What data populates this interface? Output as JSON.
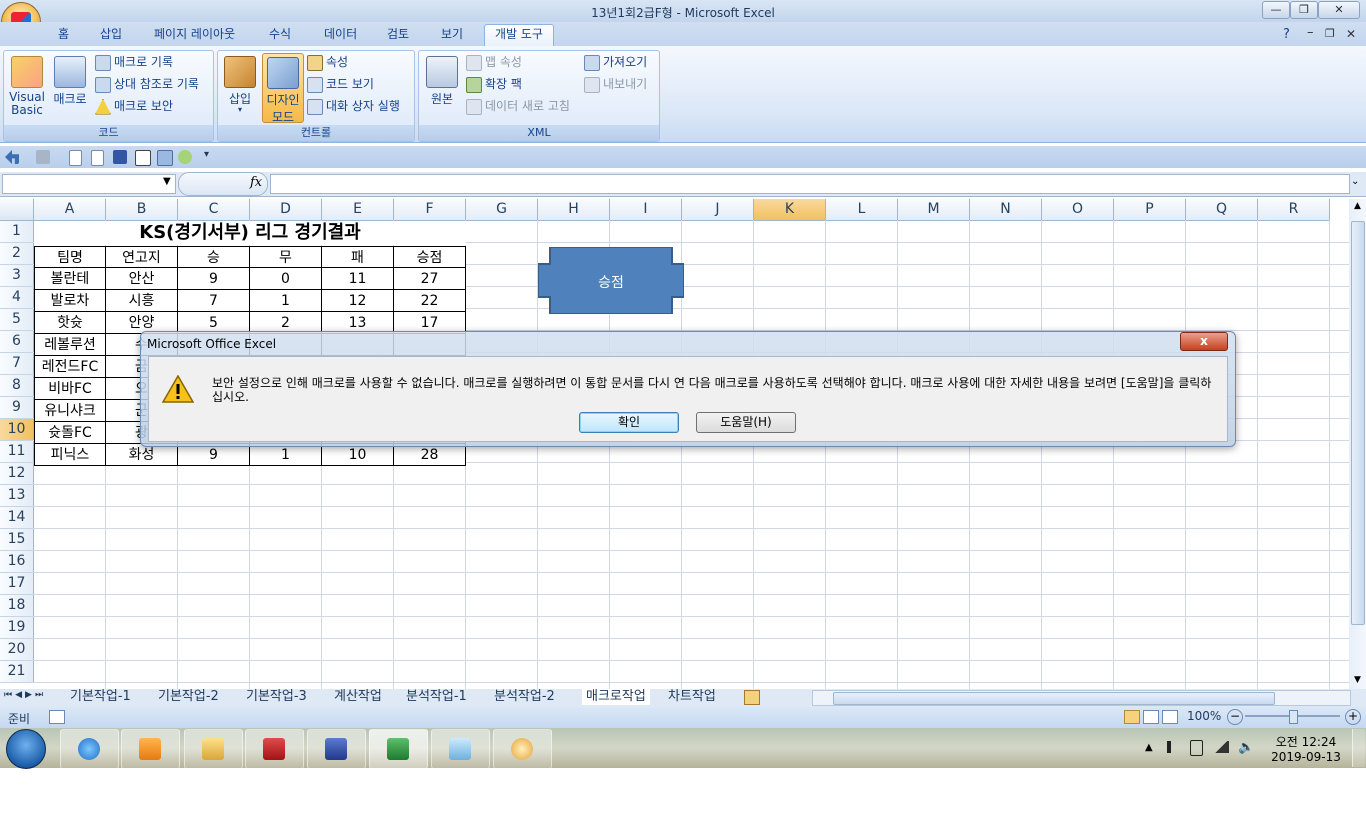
{
  "window": {
    "title": "13년1회2급F형 - Microsoft Excel",
    "minimize": "—",
    "restore": "❐",
    "close": "✕",
    "ribbon_help": "?",
    "ribbon_min": "–",
    "ribbon_restore": "❐",
    "ribbon_close": "✕"
  },
  "ribbon_tabs": [
    "홈",
    "삽입",
    "페이지 레이아웃",
    "수식",
    "데이터",
    "검토",
    "보기",
    "개발 도구"
  ],
  "ribbon": {
    "code_group": {
      "label": "코드",
      "visual_basic_line1": "Visual",
      "visual_basic_line2": "Basic",
      "macro": "매크로",
      "record_macro": "매크로 기록",
      "relative_ref": "상대 참조로 기록",
      "macro_security": "매크로 보안"
    },
    "controls_group": {
      "label": "컨트롤",
      "insert": "삽입",
      "design_mode_line1": "디자인",
      "design_mode_line2": "모드",
      "properties": "속성",
      "view_code": "코드 보기",
      "run_dialog": "대화 상자 실행"
    },
    "xml_group": {
      "label": "XML",
      "source": "원본",
      "map_properties": "맵 속성",
      "expansion_packs": "확장 팩",
      "refresh_data": "데이터 새로 고침",
      "import": "가져오기",
      "export": "내보내기"
    }
  },
  "formula_bar": {
    "name_box": "",
    "fx": "fx",
    "formula": ""
  },
  "columns": [
    "A",
    "B",
    "C",
    "D",
    "E",
    "F",
    "G",
    "H",
    "I",
    "J",
    "K",
    "L",
    "M",
    "N",
    "O",
    "P",
    "Q",
    "R"
  ],
  "rows": [
    "1",
    "2",
    "3",
    "4",
    "5",
    "6",
    "7",
    "8",
    "9",
    "10",
    "11",
    "12",
    "13",
    "14",
    "15",
    "16",
    "17",
    "18",
    "19",
    "20",
    "21"
  ],
  "sheet": {
    "title": "KS(경기서부) 리그 경기결과",
    "headers": [
      "팀명",
      "연고지",
      "승",
      "무",
      "패",
      "승점"
    ],
    "data": [
      [
        "볼란테",
        "안산",
        "9",
        "0",
        "11",
        "27"
      ],
      [
        "발로차",
        "시흥",
        "7",
        "1",
        "12",
        "22"
      ],
      [
        "핫슛",
        "안양",
        "5",
        "2",
        "13",
        "17"
      ],
      [
        "레볼루션",
        "수",
        "",
        "",
        "",
        ""
      ],
      [
        "레전드FC",
        "금",
        "",
        "",
        "",
        ""
      ],
      [
        "비바FC",
        "오",
        "",
        "",
        "",
        ""
      ],
      [
        "유니샤크",
        "군",
        "",
        "",
        "",
        ""
      ],
      [
        "슛돌FC",
        "광",
        "",
        "",
        "",
        ""
      ],
      [
        "피닉스",
        "화성",
        "9",
        "1",
        "10",
        "28"
      ]
    ],
    "shape_label": "승점"
  },
  "sheet_tabs": [
    "기본작업-1",
    "기본작업-2",
    "기본작업-3",
    "계산작업",
    "분석작업-1",
    "분석작업-2",
    "매크로작업",
    "차트작업"
  ],
  "status": {
    "ready": "준비",
    "zoom": "100%"
  },
  "dialog": {
    "title": "Microsoft Office Excel",
    "message": "보안 설정으로 인해 매크로를 사용할 수 없습니다. 매크로를 실행하려면 이 통합 문서를 다시 연 다음 매크로를 사용하도록 선택해야 합니다. 매크로 사용에 대한 자세한 내용을 보려면 [도움말]을 클릭하십시오.",
    "ok": "확인",
    "help": "도움말(H)",
    "close": "x"
  },
  "taskbar": {
    "time": "오전 12:24",
    "date": "2019-09-13"
  },
  "colors": {
    "accent": "#15428b",
    "selected_header": "#f1c15f",
    "shape_fill": "#4f81bd"
  }
}
